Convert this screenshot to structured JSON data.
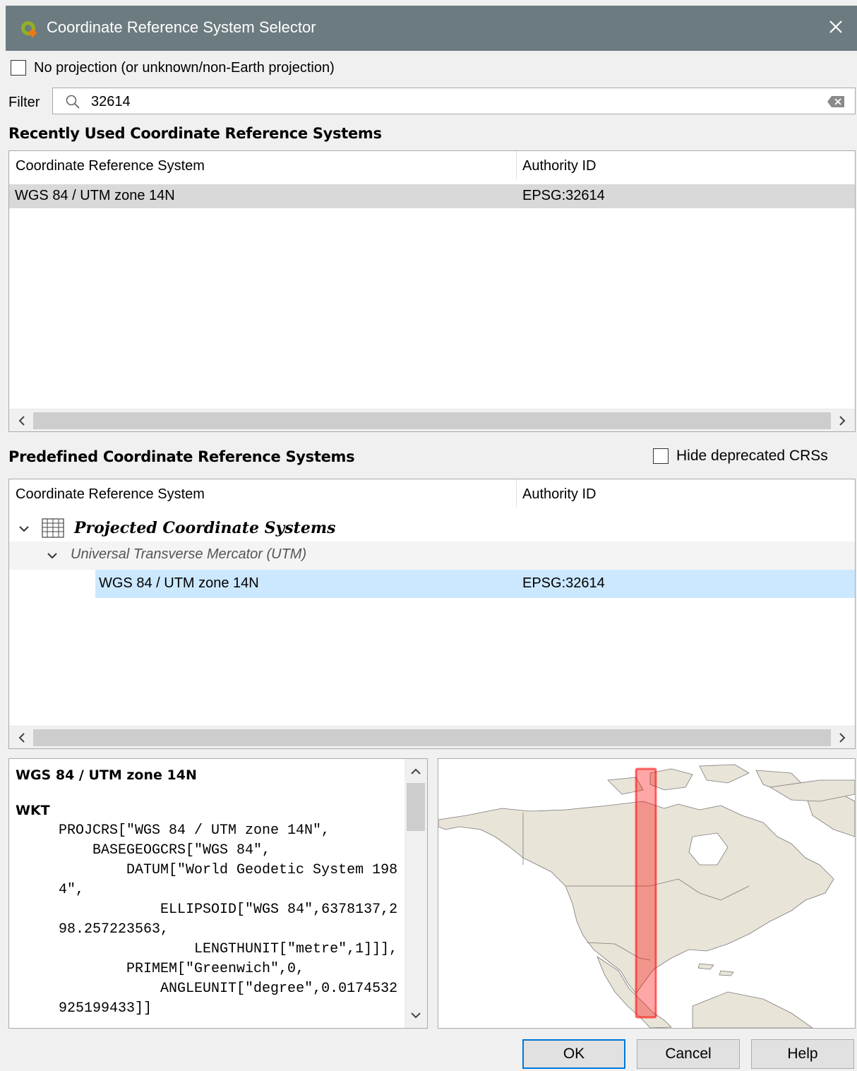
{
  "window": {
    "title": "Coordinate Reference System Selector"
  },
  "no_projection": {
    "label": "No projection (or unknown/non-Earth projection)",
    "checked": false
  },
  "filter": {
    "label": "Filter",
    "value": "32614"
  },
  "recent": {
    "title": "Recently Used Coordinate Reference Systems",
    "columns": [
      "Coordinate Reference System",
      "Authority ID"
    ],
    "rows": [
      {
        "name": "WGS 84 / UTM zone 14N",
        "id": "EPSG:32614"
      }
    ]
  },
  "predefined": {
    "title": "Predefined Coordinate Reference Systems",
    "hide_deprecated_label": "Hide deprecated CRSs",
    "hide_deprecated_checked": false,
    "columns": [
      "Coordinate Reference System",
      "Authority ID"
    ],
    "group": "Projected Coordinate Systems",
    "subgroup": "Universal Transverse Mercator (UTM)",
    "selected": {
      "name": "WGS 84 / UTM zone 14N",
      "id": "EPSG:32614"
    }
  },
  "details": {
    "heading": "WGS 84 / UTM zone 14N",
    "wkt_label": "WKT",
    "wkt_text": "PROJCRS[\"WGS 84 / UTM zone 14N\",\n    BASEGEOGCRS[\"WGS 84\",\n        DATUM[\"World Geodetic System 1984\",\n            ELLIPSOID[\"WGS 84\",6378137,298.257223563,\n                LENGTHUNIT[\"metre\",1]]],\n        PRIMEM[\"Greenwich\",0,\n            ANGLEUNIT[\"degree\",0.0174532925199433]]"
  },
  "buttons": {
    "ok": "OK",
    "cancel": "Cancel",
    "help": "Help"
  },
  "colors": {
    "titlebar": "#6b7b80",
    "selection": "#cce8ff",
    "recent_selection": "#d9d9d9",
    "extent_highlight": "#ff0000",
    "land": "#e9e4d8"
  }
}
